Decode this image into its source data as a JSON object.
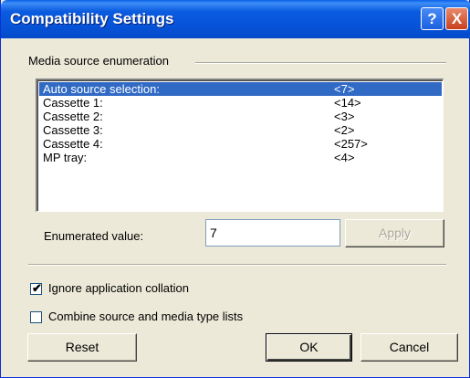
{
  "window": {
    "title": "Compatibility Settings"
  },
  "titlebar": {
    "help_glyph": "?",
    "close_glyph": "X"
  },
  "group": {
    "label": "Media source enumeration"
  },
  "list": {
    "items": [
      {
        "name": "Auto source selection:",
        "value": "<7>",
        "selected": true
      },
      {
        "name": "Cassette 1:",
        "value": "<14>",
        "selected": false
      },
      {
        "name": "Cassette 2:",
        "value": "<3>",
        "selected": false
      },
      {
        "name": "Cassette 3:",
        "value": "<2>",
        "selected": false
      },
      {
        "name": "Cassette 4:",
        "value": "<257>",
        "selected": false
      },
      {
        "name": "MP tray:",
        "value": "<4>",
        "selected": false
      }
    ]
  },
  "enumerated": {
    "label": "Enumerated value:",
    "value": "7"
  },
  "buttons": {
    "apply": "Apply",
    "reset": "Reset",
    "ok": "OK",
    "cancel": "Cancel"
  },
  "options": {
    "ignore_collation": {
      "label": "Ignore application collation",
      "checked": true
    },
    "combine_lists": {
      "label": "Combine source and media type lists",
      "checked": false
    }
  },
  "colors": {
    "selection": "#316AC5",
    "titlebar": "#0653D8",
    "face": "#ECE9D8"
  }
}
